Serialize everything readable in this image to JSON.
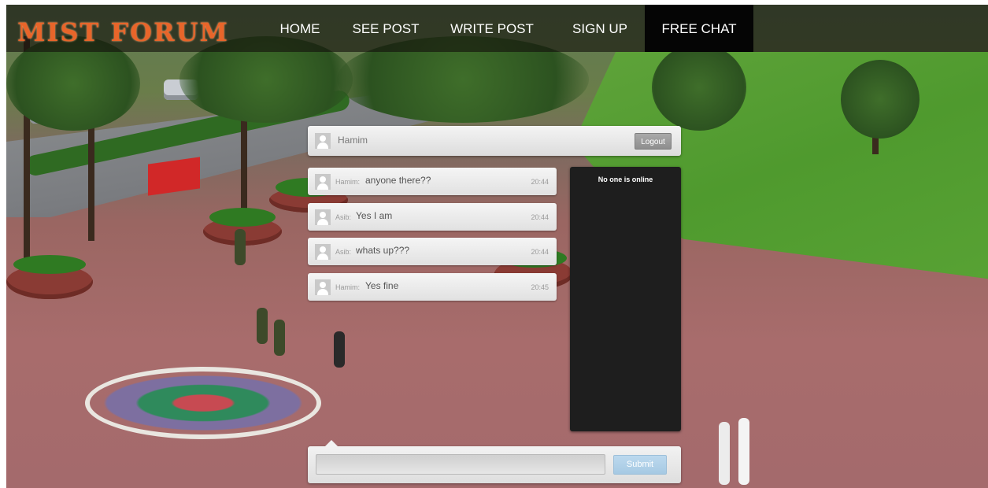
{
  "nav": {
    "logo": "MIST FORUM",
    "items": [
      {
        "label": "HOME",
        "active": false
      },
      {
        "label": "SEE POST",
        "active": false
      },
      {
        "label": "WRITE POST",
        "active": false
      },
      {
        "label": "SIGN UP",
        "active": false
      },
      {
        "label": "FREE CHAT",
        "active": true
      }
    ]
  },
  "chat": {
    "current_user": "Hamim",
    "logout_label": "Logout",
    "messages": [
      {
        "author": "Hamim:",
        "text": "anyone there??",
        "time": "20:44"
      },
      {
        "author": "Asib:",
        "text": "Yes I am",
        "time": "20:44"
      },
      {
        "author": "Asib:",
        "text": "whats up???",
        "time": "20:44"
      },
      {
        "author": "Hamim:",
        "text": "Yes fine",
        "time": "20:45"
      }
    ],
    "online_status": "No one is online",
    "input_value": "",
    "submit_label": "Submit"
  },
  "colors": {
    "logo": "#e8652a",
    "active_nav": "#050505",
    "online_panel": "#1e1e1e",
    "submit": "#a6c9e3"
  },
  "icons": {
    "avatar": "user-silhouette-icon"
  }
}
